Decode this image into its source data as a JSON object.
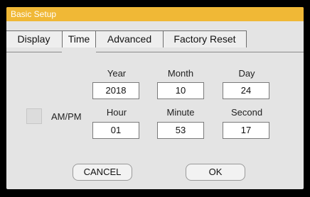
{
  "dialog": {
    "title": "Basic Setup"
  },
  "tabs": [
    {
      "label": "Display",
      "active": false
    },
    {
      "label": "Time",
      "active": true
    },
    {
      "label": "Advanced",
      "active": false
    },
    {
      "label": "Factory Reset",
      "active": false
    }
  ],
  "ampm": {
    "label": "AM/PM",
    "checked": false
  },
  "fields": {
    "year": {
      "label": "Year",
      "value": "2018"
    },
    "month": {
      "label": "Month",
      "value": "10"
    },
    "day": {
      "label": "Day",
      "value": "24"
    },
    "hour": {
      "label": "Hour",
      "value": "01"
    },
    "minute": {
      "label": "Minute",
      "value": "53"
    },
    "second": {
      "label": "Second",
      "value": "17"
    }
  },
  "buttons": {
    "cancel": "CANCEL",
    "ok": "OK"
  },
  "colors": {
    "title_bar": "#f0b836",
    "panel": "#e4e4e4",
    "frame": "#000000"
  }
}
